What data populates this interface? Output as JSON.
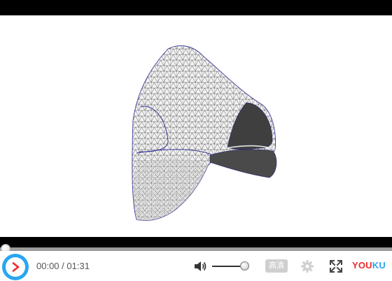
{
  "player": {
    "current_time": "00:00",
    "separator": " / ",
    "duration": "01:31",
    "progress_fraction": 0.0,
    "volume_fraction": 0.88,
    "quality_label": "高清",
    "brand": {
      "part_a": "YOU",
      "part_b": "KU"
    },
    "colors": {
      "accent": "#2aa6f0",
      "brand_red": "#ee2a2a",
      "letterbox": "#000000",
      "progress_track": "#9a9a9a",
      "icon_gray": "#d0d0d0"
    }
  },
  "icons": {
    "play": "play-icon",
    "volume": "volume-icon",
    "settings": "gear-icon",
    "fullscreen": "fullscreen-icon"
  }
}
